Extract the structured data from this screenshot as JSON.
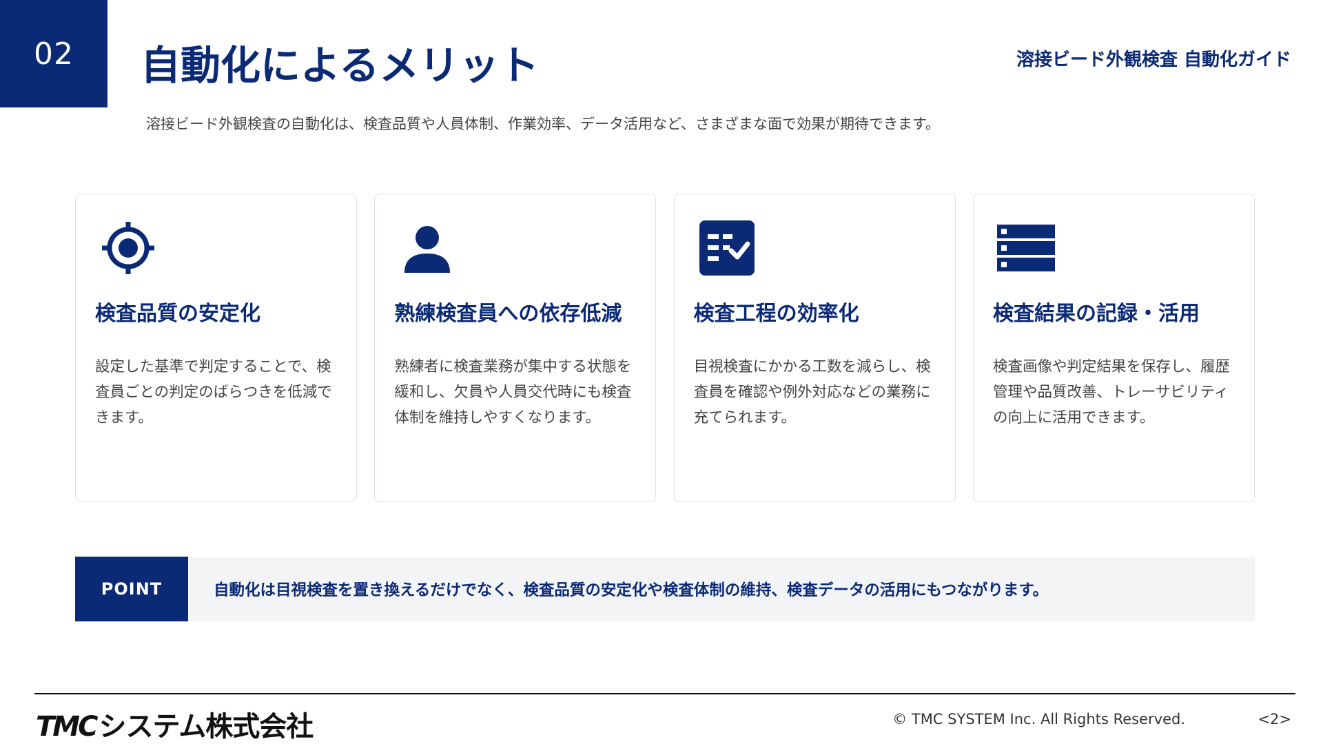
{
  "header": {
    "section_number": "02",
    "title": "自動化によるメリット",
    "guide_title": "溶接ビード外観検査 自動化ガイド",
    "subtitle": "溶接ビード外観検査の自動化は、検査品質や人員体制、作業効率、データ活用など、さまざまな面で効果が期待できます。"
  },
  "cards": [
    {
      "icon": "target-icon",
      "title": "検査品質の安定化",
      "body": "設定した基準で判定することで、検査員ごとの判定のばらつきを低減できます。"
    },
    {
      "icon": "person-icon",
      "title": "熟練検査員への依存低減",
      "body": "熟練者に検査業務が集中する状態を緩和し、欠員や人員交代時にも検査体制を維持しやすくなります。"
    },
    {
      "icon": "checklist-icon",
      "title": "検査工程の効率化",
      "body": "目視検査にかかる工数を減らし、検査員を確認や例外対応などの業務に充てられます。"
    },
    {
      "icon": "database-icon",
      "title": "検査結果の記録・活用",
      "body": "検査画像や判定結果を保存し、履歴管理や品質改善、トレーサビリティの向上に活用できます。"
    }
  ],
  "point": {
    "label": "POINT",
    "text": "自動化は目視検査を置き換えるだけでなく、検査品質の安定化や検査体制の維持、検査データの活用にもつながります。"
  },
  "footer": {
    "logo_mark": "TMC",
    "logo_text": "システム株式会社",
    "copyright": "© TMC SYSTEM Inc. All Rights Reserved.",
    "page": "<2>"
  },
  "colors": {
    "brand": "#0b2a75",
    "card_border": "#dde1e7",
    "point_bg": "#f3f4f6"
  }
}
